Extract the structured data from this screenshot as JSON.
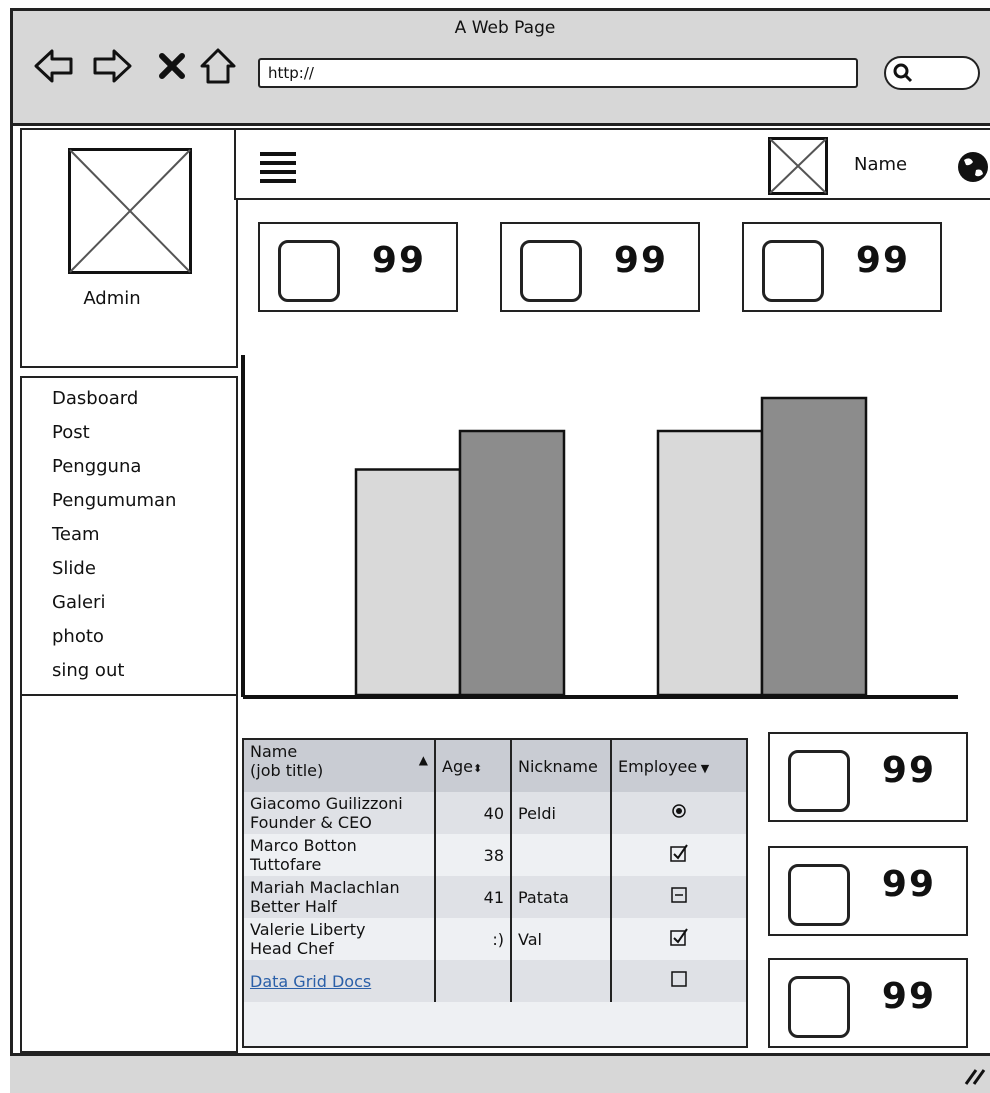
{
  "window": {
    "title": "A Web Page"
  },
  "browser": {
    "url": "http://"
  },
  "sidebar": {
    "user_label": "Admin",
    "items": [
      "Dasboard",
      "Post",
      "Pengguna",
      "Pengumuman",
      "Team",
      "Slide",
      "Galeri",
      "photo",
      "sing out"
    ]
  },
  "topnav": {
    "user_name": "Name"
  },
  "stat_cards": {
    "top": [
      "99",
      "99",
      "99"
    ],
    "right": [
      "99",
      "99",
      "99"
    ]
  },
  "chart_data": {
    "type": "bar",
    "categories": [
      "",
      ""
    ],
    "series": [
      {
        "values": [
          205,
          240
        ],
        "color": "#d9d9d9"
      },
      {
        "values": [
          240,
          270
        ],
        "color": "#8c8c8c"
      }
    ],
    "ylim": [
      0,
      300
    ],
    "title": "",
    "xlabel": "",
    "ylabel": ""
  },
  "datagrid": {
    "columns": {
      "name": "Name",
      "name_sub": "(job title)",
      "age": "Age",
      "nickname": "Nickname",
      "employee": "Employee"
    },
    "rows": [
      {
        "name": "Giacomo Guilizzoni",
        "title": "Founder & CEO",
        "age": "40",
        "nickname": "Peldi",
        "employee": "radio"
      },
      {
        "name": "Marco Botton",
        "title": "Tuttofare",
        "age": "38",
        "nickname": "",
        "employee": "checked"
      },
      {
        "name": "Mariah Maclachlan",
        "title": "Better Half",
        "age": "41",
        "nickname": "Patata",
        "employee": "indeterminate"
      },
      {
        "name": "Valerie Liberty",
        "title": "Head Chef",
        "age": ":)",
        "nickname": "Val",
        "employee": "checked"
      }
    ],
    "footer_link": "Data Grid Docs"
  }
}
